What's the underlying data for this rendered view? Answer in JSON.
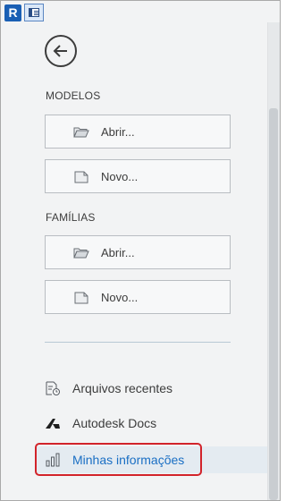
{
  "app": {
    "logo_letter": "R"
  },
  "sections": {
    "models": {
      "title": "MODELOS",
      "open_label": "Abrir...",
      "new_label": "Novo..."
    },
    "families": {
      "title": "FAMÍLIAS",
      "open_label": "Abrir...",
      "new_label": "Novo..."
    }
  },
  "nav": {
    "recent_files": "Arquivos recentes",
    "autodesk_docs": "Autodesk Docs",
    "my_info": "Minhas informações",
    "selected": "my_info"
  },
  "colors": {
    "accent": "#1a6fc4",
    "highlight_border": "#d2232a",
    "panel_background": "#f2f3f4"
  },
  "icons": {
    "logo": "revit-logo-icon",
    "panel_toggle": "panel-toggle-icon",
    "back": "back-arrow-icon",
    "open": "folder-open-icon",
    "new": "new-file-icon",
    "recent": "recent-files-icon",
    "docs": "autodesk-docs-icon",
    "info": "bar-chart-icon"
  }
}
